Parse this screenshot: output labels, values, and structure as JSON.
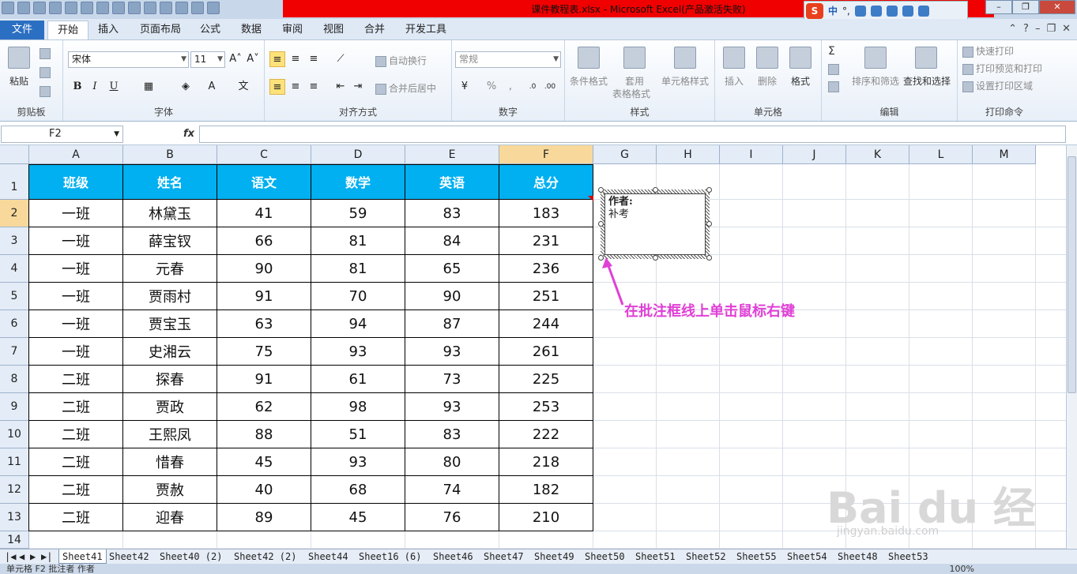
{
  "window": {
    "title": "课件教程表.xlsx - Microsoft Excel(产品激活失败)"
  },
  "ime": {
    "lang": "中",
    "punct": "°,"
  },
  "ribbon_tabs": [
    "文件",
    "开始",
    "插入",
    "页面布局",
    "公式",
    "数据",
    "审阅",
    "视图",
    "合并",
    "开发工具"
  ],
  "clipboard": {
    "paste": "粘贴",
    "group": "剪贴板"
  },
  "font": {
    "name": "宋体",
    "size": "11",
    "group": "字体",
    "bold": "B",
    "italic": "I",
    "underline": "U"
  },
  "alignment": {
    "wrap": "自动换行",
    "merge": "合并后居中",
    "group": "对齐方式"
  },
  "number": {
    "format": "常规",
    "percent": "%",
    "comma": ",",
    "group": "数字"
  },
  "styles": {
    "conditional": "条件格式",
    "table_line1": "套用",
    "table_line2": "表格格式",
    "cell_styles": "单元格样式",
    "group": "样式"
  },
  "cells": {
    "insert": "插入",
    "delete": "删除",
    "format": "格式",
    "group": "单元格"
  },
  "editing": {
    "sort_filter": "排序和筛选",
    "find_select": "查找和选择",
    "sigma": "Σ",
    "group": "编辑"
  },
  "print": {
    "quick": "快速打印",
    "preview": "打印预览和打印",
    "area": "设置打印区域",
    "group": "打印命令"
  },
  "formula_bar": {
    "name_box": "F2",
    "fx": "fx",
    "value": ""
  },
  "columns": [
    "A",
    "B",
    "C",
    "D",
    "E",
    "F",
    "G",
    "H",
    "I",
    "J",
    "K",
    "L",
    "M"
  ],
  "rows": [
    "1",
    "2",
    "3",
    "4",
    "5",
    "6",
    "7",
    "8",
    "9",
    "10",
    "11",
    "12",
    "13",
    "14"
  ],
  "table": {
    "headers": [
      "班级",
      "姓名",
      "语文",
      "数学",
      "英语",
      "总分"
    ],
    "rows": [
      [
        "一班",
        "林黛玉",
        "41",
        "59",
        "83",
        "183"
      ],
      [
        "一班",
        "薛宝钗",
        "66",
        "81",
        "84",
        "231"
      ],
      [
        "一班",
        "元春",
        "90",
        "81",
        "65",
        "236"
      ],
      [
        "一班",
        "贾雨村",
        "91",
        "70",
        "90",
        "251"
      ],
      [
        "一班",
        "贾宝玉",
        "63",
        "94",
        "87",
        "244"
      ],
      [
        "一班",
        "史湘云",
        "75",
        "93",
        "93",
        "261"
      ],
      [
        "二班",
        "探春",
        "91",
        "61",
        "73",
        "225"
      ],
      [
        "二班",
        "贾政",
        "62",
        "98",
        "93",
        "253"
      ],
      [
        "二班",
        "王熙凤",
        "88",
        "51",
        "83",
        "222"
      ],
      [
        "二班",
        "惜春",
        "45",
        "93",
        "80",
        "218"
      ],
      [
        "二班",
        "贾赦",
        "40",
        "68",
        "74",
        "182"
      ],
      [
        "二班",
        "迎春",
        "89",
        "45",
        "76",
        "210"
      ]
    ]
  },
  "comment": {
    "author": "作者:",
    "text": "补考"
  },
  "annotation": "在批注框线上单击鼠标右键",
  "watermark": {
    "brand": "Bai du 经验",
    "url": "jingyan.baidu.com"
  },
  "sheet_tabs": [
    "Sheet41",
    "Sheet42",
    "Sheet40 (2)",
    "Sheet42 (2)",
    "Sheet44",
    "Sheet16 (6)",
    "Sheet46",
    "Sheet47",
    "Sheet49",
    "Sheet50",
    "Sheet51",
    "Sheet52",
    "Sheet55",
    "Sheet54",
    "Sheet48",
    "Sheet53"
  ],
  "status": {
    "text": "单元格 F2 批注者 作者",
    "zoom": "100%"
  },
  "colors": {
    "header_fill": "#00b0f0",
    "annotation": "#e040d6",
    "title_bar": "#f00000"
  }
}
